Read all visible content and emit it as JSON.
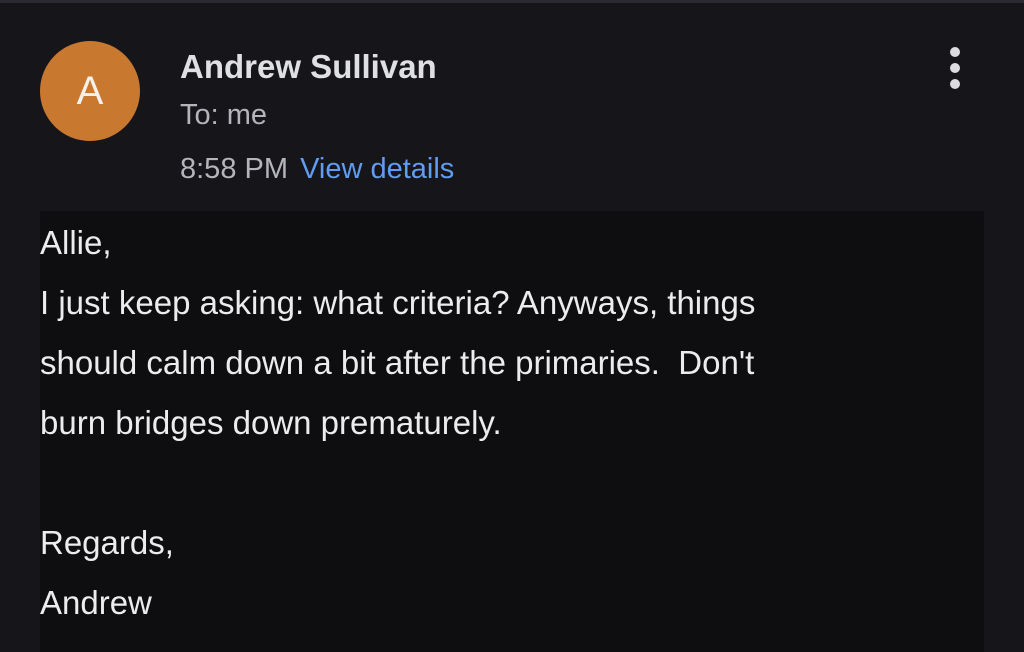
{
  "header": {
    "avatar_initial": "A",
    "sender_name": "Andrew Sullivan",
    "recipient": "To: me",
    "time": "8:58 PM",
    "view_details": "View details"
  },
  "colors": {
    "avatar_bg": "#c8782f",
    "link": "#5f9cf2",
    "background": "#16161a",
    "body_background": "#0e0e10"
  },
  "icons": {
    "more": "more-vertical-icon"
  },
  "body": {
    "lines": [
      "Allie,",
      "I just keep asking: what criteria? Anyways, things",
      "should calm down a bit after the primaries.  Don't",
      "burn bridges down prematurely.",
      "",
      "Regards,",
      "Andrew"
    ]
  }
}
